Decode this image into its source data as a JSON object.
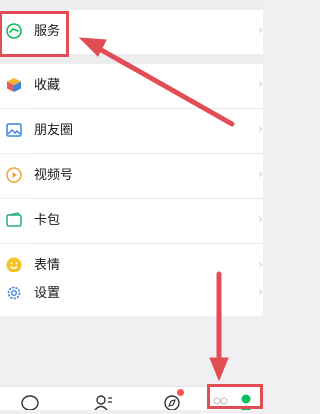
{
  "menu": {
    "items": [
      {
        "label": "服务",
        "icon": "service-icon",
        "color": "#17b85c"
      },
      {
        "label": "收藏",
        "icon": "favorites-cube-icon",
        "color": "#f5b731"
      },
      {
        "label": "朋友圈",
        "icon": "moments-picture-icon",
        "color": "#3c83e0"
      },
      {
        "label": "视频号",
        "icon": "channels-play-icon",
        "color": "#f0a43b"
      },
      {
        "label": "卡包",
        "icon": "card-wallet-icon",
        "color": "#2da88f"
      },
      {
        "label": "表情",
        "icon": "sticker-face-icon",
        "color": "#f6c127"
      },
      {
        "label": "设置",
        "icon": "settings-gear-icon",
        "color": "#3c83e0"
      }
    ]
  },
  "tabbar": {
    "tabs": [
      {
        "name": "chats",
        "icon": "chat-bubble-icon",
        "selected": false
      },
      {
        "name": "contacts",
        "icon": "contacts-icon",
        "selected": false
      },
      {
        "name": "discover",
        "icon": "compass-icon",
        "selected": false,
        "badge_dot": true
      },
      {
        "name": "me",
        "icon": "me-person-icon",
        "selected": true
      }
    ]
  },
  "colors": {
    "annotation": "#e24c55",
    "accent": "#07c160",
    "badge": "#fa5151"
  }
}
